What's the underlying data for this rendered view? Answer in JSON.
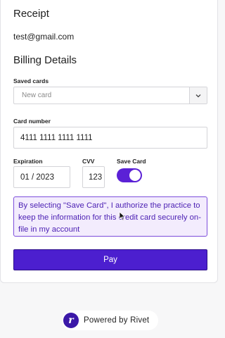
{
  "receipt": {
    "title": "Receipt",
    "email": "test@gmail.com"
  },
  "billing": {
    "title": "Billing Details",
    "saved_cards": {
      "label": "Saved cards",
      "selected": "New card"
    },
    "card_number": {
      "label": "Card number",
      "value": "4111 1111 1111 1111"
    },
    "expiration": {
      "label": "Expiration",
      "value": "01 / 2023"
    },
    "cvv": {
      "label": "CVV",
      "value": "123"
    },
    "save_card": {
      "label": "Save Card",
      "enabled": true
    },
    "notice": "By selecting \"Save Card\", I authorize the practice to keep the information for this credit card securely on-file in my account",
    "pay_label": "Pay"
  },
  "footer": {
    "logo_letter": "r",
    "powered_by": "Powered by Rivet"
  },
  "colors": {
    "accent": "#4c1fcf",
    "toggle_on": "#5b21d6",
    "notice_bg": "#f3ecfd",
    "notice_text": "#4b1fb3",
    "page_bg": "#f7f7f8"
  },
  "icons": {
    "select_arrow": "chevron-down-icon",
    "logo": "rivet-logo-icon",
    "cursor": "mouse-pointer-icon"
  }
}
